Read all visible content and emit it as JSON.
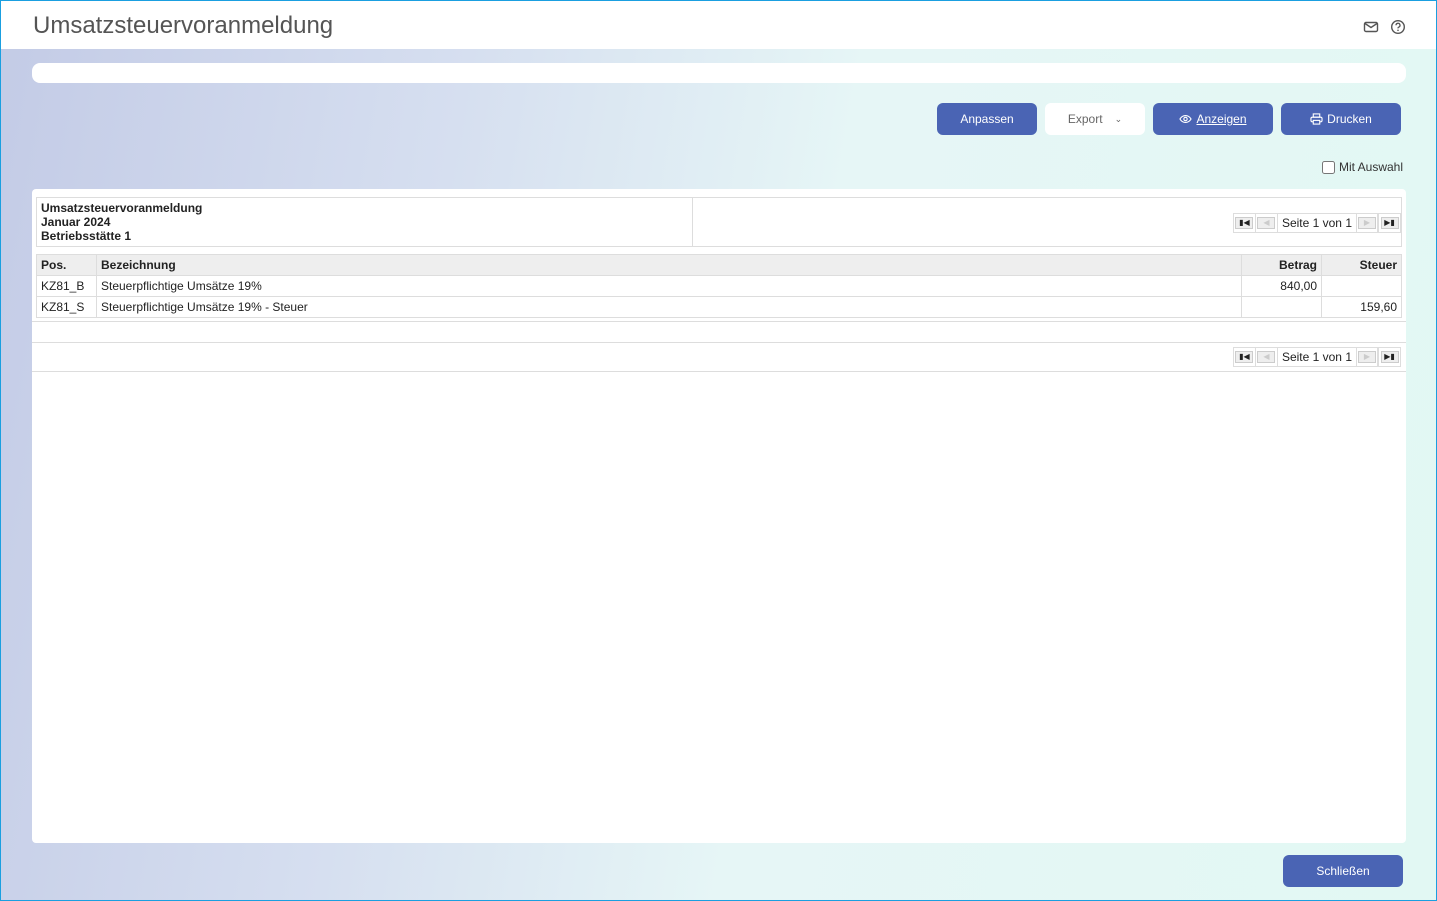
{
  "header": {
    "title": "Umsatzsteuervoranmeldung"
  },
  "toolbar": {
    "customize": "Anpassen",
    "export": "Export",
    "show": "Anzeigen",
    "print": "Drucken",
    "with_selection": "Mit Auswahl"
  },
  "report": {
    "title": "Umsatzsteuervoranmeldung",
    "period": "Januar 2024",
    "site": "Betriebsstätte 1"
  },
  "pager": {
    "text": "Seite 1 von 1"
  },
  "table": {
    "columns": [
      "Pos.",
      "Bezeichnung",
      "Betrag",
      "Steuer"
    ],
    "rows": [
      [
        "KZ81_B",
        "Steuerpflichtige Umsätze 19%",
        "840,00",
        ""
      ],
      [
        "KZ81_S",
        "Steuerpflichtige Umsätze 19% - Steuer",
        "",
        "159,60"
      ]
    ]
  },
  "footer": {
    "close": "Schließen"
  }
}
